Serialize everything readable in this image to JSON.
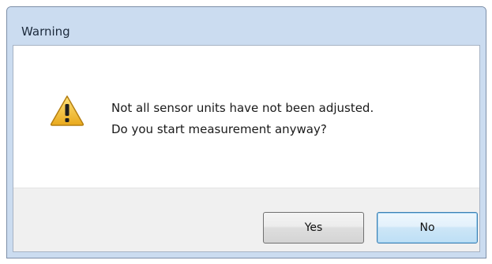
{
  "window": {
    "title": "Warning"
  },
  "message": {
    "icon": "warning-icon",
    "line1": "Not all sensor units have not been adjusted.",
    "line2": "Do you start measurement anyway?"
  },
  "buttons": {
    "yes_label": "Yes",
    "no_label": "No",
    "default": "No"
  },
  "colors": {
    "titlebar": "#cbdcf0",
    "warning_yellow": "#f6c93b",
    "default_button_border": "#3c7fb1"
  }
}
